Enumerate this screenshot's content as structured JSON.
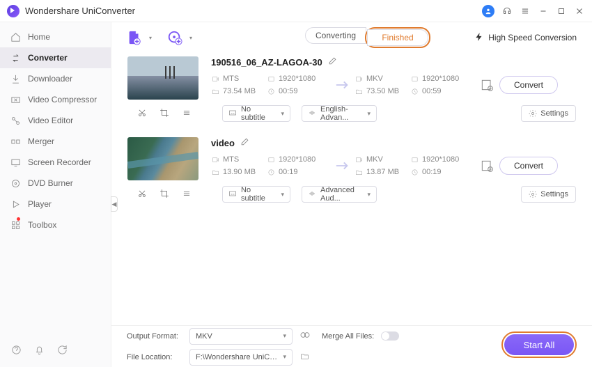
{
  "app_title": "Wondershare UniConverter",
  "sidebar": {
    "items": [
      {
        "label": "Home"
      },
      {
        "label": "Converter"
      },
      {
        "label": "Downloader"
      },
      {
        "label": "Video Compressor"
      },
      {
        "label": "Video Editor"
      },
      {
        "label": "Merger"
      },
      {
        "label": "Screen Recorder"
      },
      {
        "label": "DVD Burner"
      },
      {
        "label": "Player"
      },
      {
        "label": "Toolbox"
      }
    ]
  },
  "tabs": {
    "converting": "Converting",
    "finished": "Finished"
  },
  "high_speed": "High Speed Conversion",
  "files": [
    {
      "name": "190516_06_AZ-LAGOA-30",
      "src": {
        "fmt": "MTS",
        "res": "1920*1080",
        "size": "73.54 MB",
        "dur": "00:59"
      },
      "out": {
        "fmt": "MKV",
        "res": "1920*1080",
        "size": "73.50 MB",
        "dur": "00:59"
      },
      "subtitle": "No subtitle",
      "audio": "English-Advan...",
      "convert": "Convert",
      "settings": "Settings"
    },
    {
      "name": "video",
      "src": {
        "fmt": "MTS",
        "res": "1920*1080",
        "size": "13.90 MB",
        "dur": "00:19"
      },
      "out": {
        "fmt": "MKV",
        "res": "1920*1080",
        "size": "13.87 MB",
        "dur": "00:19"
      },
      "subtitle": "No subtitle",
      "audio": "Advanced Aud...",
      "convert": "Convert",
      "settings": "Settings"
    }
  ],
  "footer": {
    "output_format_label": "Output Format:",
    "output_format_value": "MKV",
    "merge_label": "Merge All Files:",
    "file_location_label": "File Location:",
    "file_location_value": "F:\\Wondershare UniConverter",
    "start_all": "Start All"
  }
}
